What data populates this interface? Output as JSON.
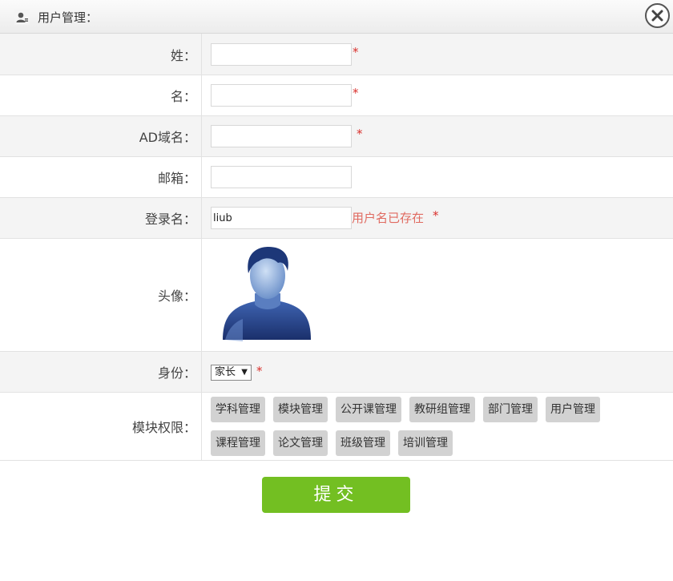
{
  "dialog": {
    "title": "用户管理：",
    "title_icon": "user-icon",
    "close_icon": "close-icon"
  },
  "form": {
    "surname_label": "姓：",
    "given_name_label": "名：",
    "ad_domain_label": "AD域名：",
    "email_label": "邮箱：",
    "login_label": "登录名：",
    "avatar_label": "头像：",
    "identity_label": "身份：",
    "modules_label": "模块权限：",
    "surname_value": "",
    "given_name_value": "",
    "ad_domain_value": "",
    "email_value": "",
    "login_value": "liub",
    "login_error": "用户名已存在",
    "required_mark": "*",
    "identity_value": "家长",
    "modules": [
      "学科管理",
      "模块管理",
      "公开课管理",
      "教研组管理",
      "部门管理",
      "用户管理",
      "课程管理",
      "论文管理",
      "班级管理",
      "培训管理"
    ]
  },
  "submit_label": "提交",
  "colors": {
    "submit": "#73bf22",
    "required": "#d9302c",
    "error": "#e06a60",
    "tag_bg": "#d2d2d2",
    "row_shade": "#f4f4f4"
  }
}
